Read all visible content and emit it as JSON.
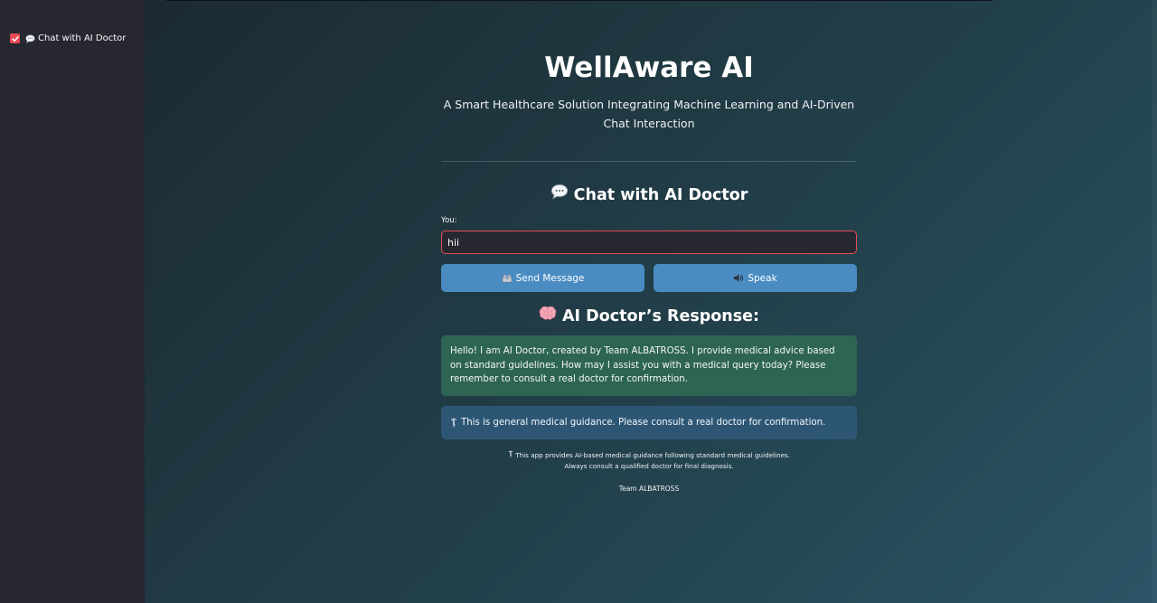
{
  "sidebar": {
    "checkbox_checked": true,
    "item_icon": "speech-balloon-icon",
    "item_label": "Chat with AI Doctor"
  },
  "header": {
    "title": "WellAware AI",
    "subtitle": "A Smart Healthcare Solution Integrating Machine Learning and AI-Driven Chat Interaction"
  },
  "chat": {
    "heading_icon": "speech-balloon-icon",
    "heading": "Chat with AI Doctor",
    "input_label": "You:",
    "input_value": "hii",
    "send_icon": "inbox-tray-icon",
    "send_label": "Send Message",
    "speak_icon": "speaker-icon",
    "speak_label": "Speak"
  },
  "response": {
    "heading_icon": "brain-icon",
    "heading": "AI Doctor’s Response:",
    "text": "Hello! I am AI Doctor, created by Team ALBATROSS. I provide medical advice based on standard guidelines. How may I assist you with a medical query today? Please remember to consult a real doctor for confirmation.",
    "notice_icon": "caduceus-icon",
    "notice": "This is general medical guidance. Please consult a real doctor for confirmation."
  },
  "footer": {
    "line1": "This app provides AI-based medical guidance following standard medical guidelines.",
    "line2": "Always consult a qualified doctor for final diagnosis.",
    "team": "Team ALBATROSS"
  },
  "colors": {
    "accent_red": "#e84a55",
    "button_blue": "#4a8cc2",
    "response_green": "#2e6454",
    "notice_blue": "#2d5674",
    "sidebar_bg": "#262730"
  }
}
